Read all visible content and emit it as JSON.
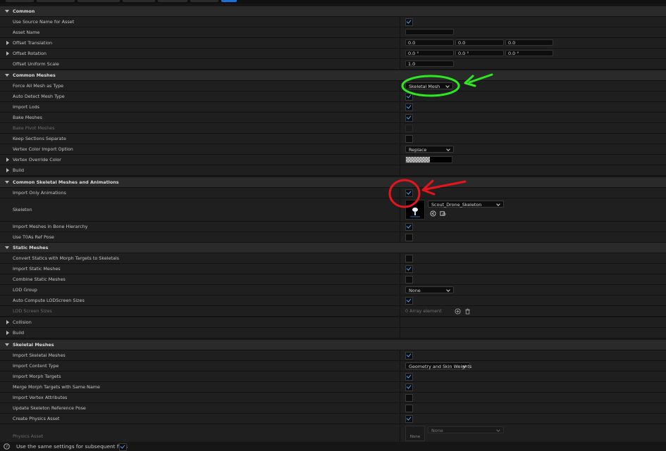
{
  "sections": {
    "common": {
      "title": "Common",
      "use_source_name": "Use Source Name for Asset",
      "asset_name": "Asset Name",
      "offset_translation": "Offset Translation",
      "offset_translation_values": [
        "0.0",
        "0.0",
        "0.0"
      ],
      "offset_rotation": "Offset Rotation",
      "offset_rotation_values": [
        "0.0 °",
        "0.0 °",
        "0.0 °"
      ],
      "offset_uniform_scale": "Offset Uniform Scale",
      "offset_uniform_scale_value": "1.0"
    },
    "common_meshes": {
      "title": "Common Meshes",
      "force_all_mesh": "Force All Mesh as Type",
      "force_all_mesh_value": "Skeletal Mesh",
      "auto_detect": "Auto Detect Mesh Type",
      "import_lods": "Import Lods",
      "bake_meshes": "Bake Meshes",
      "bake_pivot": "Bake Pivot Meshes",
      "keep_sections": "Keep Sections Separate",
      "vertex_color_option": "Vertex Color Import Option",
      "vertex_color_option_value": "Replace",
      "vertex_override_color": "Vertex Override Color",
      "build": "Build"
    },
    "common_skeletal": {
      "title": "Common Skeletal Meshes and Animations",
      "import_only_animations": "Import Only Animations",
      "skeleton": "Skeleton",
      "skeleton_value": "Scout_Drone_Skeleton",
      "import_meshes_bone": "Import Meshes in Bone Hierarchy",
      "use_t0as": "Use T0As Ref Pose"
    },
    "static_meshes": {
      "title": "Static Meshes",
      "convert_statics": "Convert Statics with Morph Targets to Skeletals",
      "import_static": "Import Static Meshes",
      "combine_static": "Combine Static Meshes",
      "lod_group": "LOD Group",
      "lod_group_value": "None",
      "auto_compute": "Auto Compute LODScreen Sizes",
      "lod_screen_sizes": "LOD Screen Sizes",
      "lod_screen_sizes_value": "0 Array element",
      "collision": "Collision",
      "build": "Build"
    },
    "skeletal_meshes": {
      "title": "Skeletal Meshes",
      "import_skeletal": "Import Skeletal Meshes",
      "import_content_type": "Import Content Type",
      "import_content_type_value": "Geometry and Skin Weights",
      "import_morph": "Import Morph Targets",
      "merge_morph": "Merge Morph Targets with Same Name",
      "import_vertex_attr": "Import Vertex Attributes",
      "update_skeleton_ref": "Update Skeleton Reference Pose",
      "create_physics": "Create Physics Asset",
      "physics_asset": "Physics Asset",
      "physics_asset_value": "None",
      "physics_thumb": "None"
    }
  },
  "footer": {
    "same_settings": "Use the same settings for subsequent files"
  },
  "colors": {
    "accent": "#1d6fd6",
    "green_annotation": "#2ee81f",
    "red_annotation": "#e8141c"
  }
}
